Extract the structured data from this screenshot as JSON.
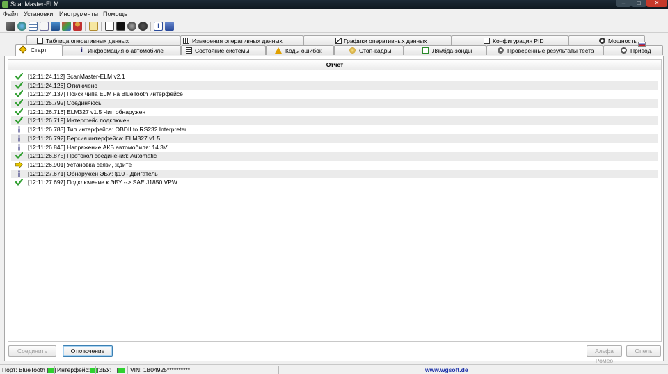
{
  "window": {
    "title": "ScanMaster-ELM",
    "min": "–",
    "max": "□",
    "close": "✕"
  },
  "menu": [
    "Файл",
    "Установки",
    "Инструменты",
    "Помощь"
  ],
  "toolbar_icons": [
    "wrench-icon",
    "globe-icon",
    "table-icon",
    "clipboard-icon",
    "chart-icon",
    "dashboard-icon",
    "person-icon",
    "page-icon",
    "chat-icon",
    "terminal-icon",
    "record-icon",
    "info-icon",
    "book-icon"
  ],
  "tabs_row1": [
    {
      "label": "Таблица оперативных данных",
      "icon": "grid-icon"
    },
    {
      "label": "Измерения оперативных данных",
      "icon": "gauge-icon"
    },
    {
      "label": "Графики оперативных данных",
      "icon": "chart-icon"
    },
    {
      "label": "Конфигурация PID",
      "icon": "config-icon"
    },
    {
      "label": "Мощность",
      "icon": "power-icon"
    }
  ],
  "tabs_row2": [
    {
      "label": "Старт",
      "icon": "start-icon",
      "active": true
    },
    {
      "label": "Информация о автомобиле",
      "icon": "info-icon"
    },
    {
      "label": "Состояние системы",
      "icon": "system-icon"
    },
    {
      "label": "Коды ошибок",
      "icon": "warning-icon"
    },
    {
      "label": "Стоп-кадры",
      "icon": "snapshot-icon"
    },
    {
      "label": "Лямбда-зонды",
      "icon": "sensor-icon"
    },
    {
      "label": "Проверенные результаты теста",
      "icon": "gear-icon"
    },
    {
      "label": "Привод",
      "icon": "steering-icon"
    }
  ],
  "report": {
    "title": "Отчёт",
    "entries": [
      {
        "icon": "check",
        "text": "[12:11:24.112] ScanMaster-ELM v2.1"
      },
      {
        "icon": "check",
        "text": "[12:11:24.126] Отключено"
      },
      {
        "icon": "check",
        "text": "[12:11:24.137] Поиск чипа ELM на BlueTooth интерфейсе"
      },
      {
        "icon": "check",
        "text": "[12:11:25.792] Соединяюсь"
      },
      {
        "icon": "check",
        "text": "[12:11:26.716] ELM327 v1.5 Чип обнаружен"
      },
      {
        "icon": "check",
        "text": "[12:11:26.719] Интерфейс подключен"
      },
      {
        "icon": "info",
        "text": "[12:11:26.783] Тип интерфейса: OBDII to RS232 Interpreter"
      },
      {
        "icon": "info",
        "text": "[12:11:26.792] Версия интерфейса: ELM327 v1.5"
      },
      {
        "icon": "info",
        "text": "[12:11:26.846] Напряжение АКБ автомобиля: 14.3V"
      },
      {
        "icon": "check",
        "text": "[12:11:26.875] Протокол соединения: Automatic"
      },
      {
        "icon": "arrow",
        "text": "[12:11:26.901] Установка связи, ждите"
      },
      {
        "icon": "info",
        "text": "[12:11:27.671] Обнаружен ЭБУ: $10 - Двигатель"
      },
      {
        "icon": "check",
        "text": "[12:11:27.697] Подключение к ЭБУ --> SAE J1850 VPW"
      }
    ]
  },
  "buttons": {
    "connect": "Соединить",
    "disconnect": "Отключение",
    "alfa": "Альфа Ромео",
    "opel": "Опель"
  },
  "status": {
    "port": "Порт: BlueTooth",
    "interface": "Интерфейс:",
    "ecu": "ЭБУ:",
    "vin": "VIN: 1B04925**********",
    "site": "www.wgsoft.de"
  },
  "colors": {
    "check": "#2e9e2e",
    "info": "#1a1a6e",
    "arrow": "#e8c800",
    "led": "#2fd12f",
    "link": "#1a2fa8"
  }
}
